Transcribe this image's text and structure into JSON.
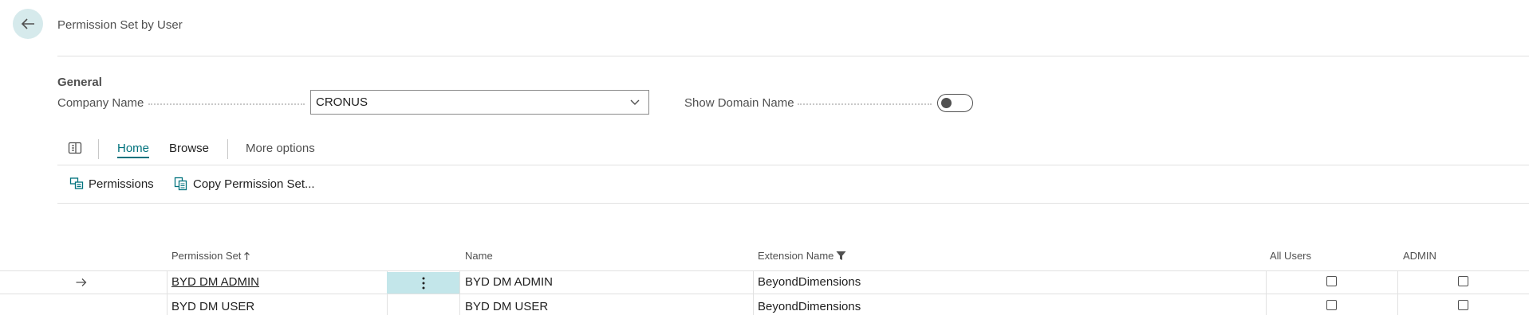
{
  "header": {
    "title": "Permission Set by User",
    "back_icon": "arrow-left-icon"
  },
  "general": {
    "section_title": "General",
    "company_label": "Company Name",
    "company_value": "CRONUS",
    "domain_label": "Show Domain Name",
    "domain_on": false
  },
  "tabs": [
    {
      "label": "Home",
      "active": true
    },
    {
      "label": "Browse",
      "active": false
    },
    {
      "label": "More options",
      "active": false
    }
  ],
  "actions": [
    {
      "label": "Permissions",
      "icon": "permissions-icon"
    },
    {
      "label": "Copy Permission Set...",
      "icon": "copy-icon"
    }
  ],
  "table": {
    "headers": {
      "permission_set": "Permission Set",
      "name": "Name",
      "extension": "Extension Name",
      "all_users": "All Users",
      "admin": "ADMIN"
    },
    "rows": [
      {
        "permission_set": "BYD DM ADMIN",
        "name": "BYD DM ADMIN",
        "extension": "BeyondDimensions",
        "all_users": false,
        "admin": false,
        "selected": true
      },
      {
        "permission_set": "BYD DM USER",
        "name": "BYD DM USER",
        "extension": "BeyondDimensions",
        "all_users": false,
        "admin": false,
        "selected": false
      }
    ]
  },
  "colors": {
    "accent": "#00727d",
    "selection": "#c3e6ea",
    "back_bg": "#d6eaec"
  }
}
